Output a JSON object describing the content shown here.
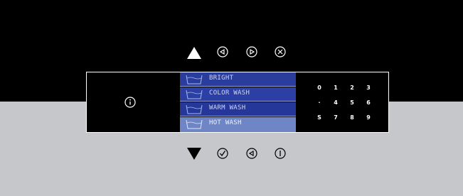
{
  "top_controls": {
    "up_icon": "triangle-up",
    "back_icon": "circle-left",
    "forward_icon": "circle-right",
    "close_icon": "circle-x"
  },
  "info_icon": "circle-i",
  "programs": [
    {
      "label": "BRIGHT",
      "selected": false
    },
    {
      "label": "COLOR WASH",
      "selected": false
    },
    {
      "label": "WARM WASH",
      "selected": false
    },
    {
      "label": "HOT WASH",
      "selected": true
    }
  ],
  "keypad": {
    "rows": [
      [
        "0",
        "1",
        "2",
        "3"
      ],
      [
        "·",
        "4",
        "5",
        "6"
      ],
      [
        "S",
        "7",
        "8",
        "9"
      ]
    ]
  },
  "bottom_controls": {
    "down_icon": "triangle-down",
    "confirm_icon": "circle-check",
    "back_icon": "circle-left",
    "power_icon": "circle-power"
  },
  "colors": {
    "background_top": "#000000",
    "background_bottom": "#c6c7cb",
    "program_row": "#2a3c9c",
    "program_selected": "#6e86c6"
  }
}
